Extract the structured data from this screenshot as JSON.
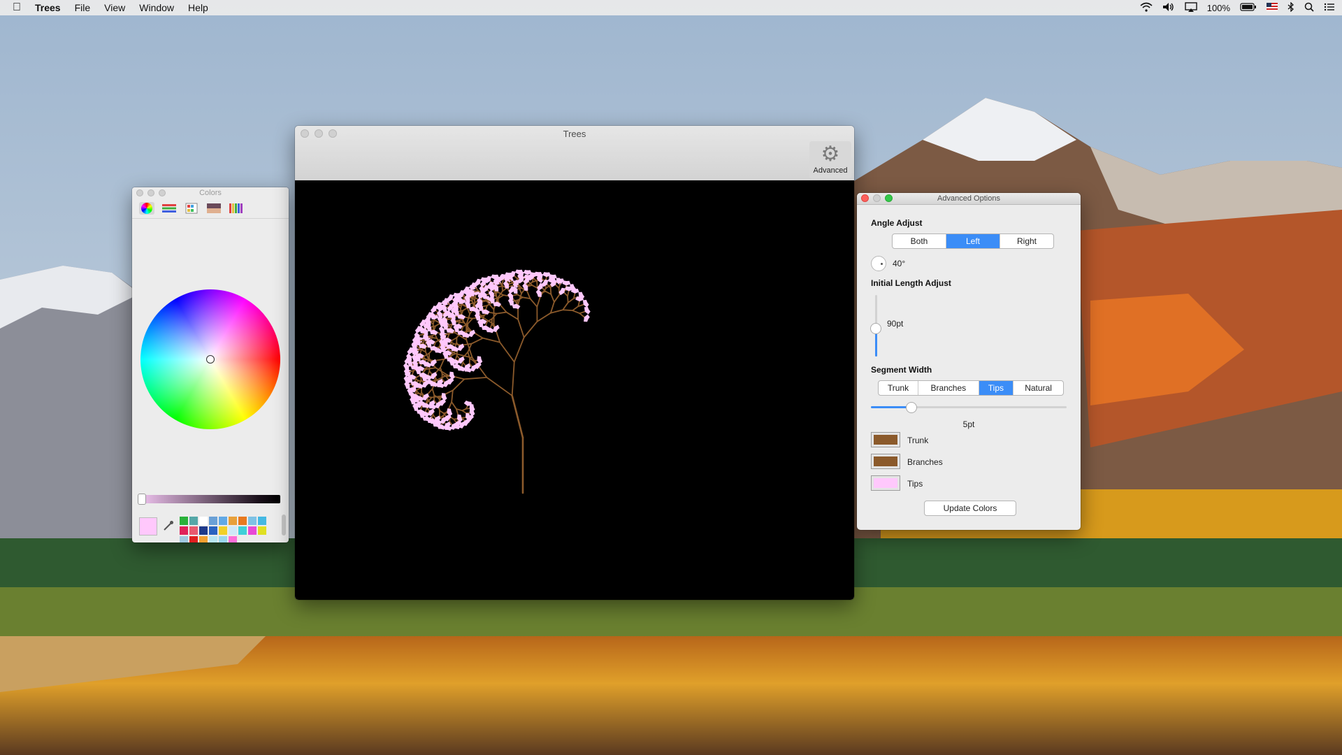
{
  "menubar": {
    "app_name": "Trees",
    "menus": [
      "File",
      "View",
      "Window",
      "Help"
    ],
    "battery": "100%",
    "status_icons": [
      "wifi-icon",
      "volume-icon",
      "airplay-icon",
      "battery-icon",
      "flag-icon",
      "bluetooth-icon",
      "search-icon",
      "list-icon"
    ]
  },
  "trees_window": {
    "title": "Trees",
    "advanced_label": "Advanced"
  },
  "colors_panel": {
    "title": "Colors",
    "tabs": [
      "color-wheel-icon",
      "sliders-icon",
      "palettes-icon",
      "image-palette-icon",
      "pencils-icon"
    ],
    "current_color": "#ffc8fc",
    "swatches": [
      "#2ab13a",
      "#55a7a7",
      "#ffffff",
      "#6aa0d6",
      "#62a9e6",
      "#e8a03a",
      "#e8791f",
      "#7ec2e5",
      "#45b9e3",
      "#e0225a",
      "#e85a6e",
      "#1e3a8a",
      "#2a63c0",
      "#f2d028",
      "#cfe9f7",
      "#3fd0d8",
      "#e84ad6",
      "#e0e022",
      "#a0c8e0",
      "#e02020",
      "#f3a030",
      "#b8e6f2",
      "#9ad7ee",
      "#ff6fd8"
    ]
  },
  "advanced_options": {
    "title": "Advanced Options",
    "angle_adjust": {
      "label": "Angle Adjust",
      "options": [
        "Both",
        "Left",
        "Right"
      ],
      "selected": "Left",
      "value": "40°"
    },
    "initial_length": {
      "label": "Initial Length Adjust",
      "value": "90pt"
    },
    "segment_width": {
      "label": "Segment Width",
      "options": [
        "Trunk",
        "Branches",
        "Tips",
        "Natural"
      ],
      "selected": "Tips",
      "value": "5pt"
    },
    "color_wells": [
      {
        "label": "Trunk",
        "color": "#8b5a2b"
      },
      {
        "label": "Branches",
        "color": "#8b5a2b"
      },
      {
        "label": "Tips",
        "color": "#ffc8fc"
      }
    ],
    "update_button": "Update Colors"
  }
}
